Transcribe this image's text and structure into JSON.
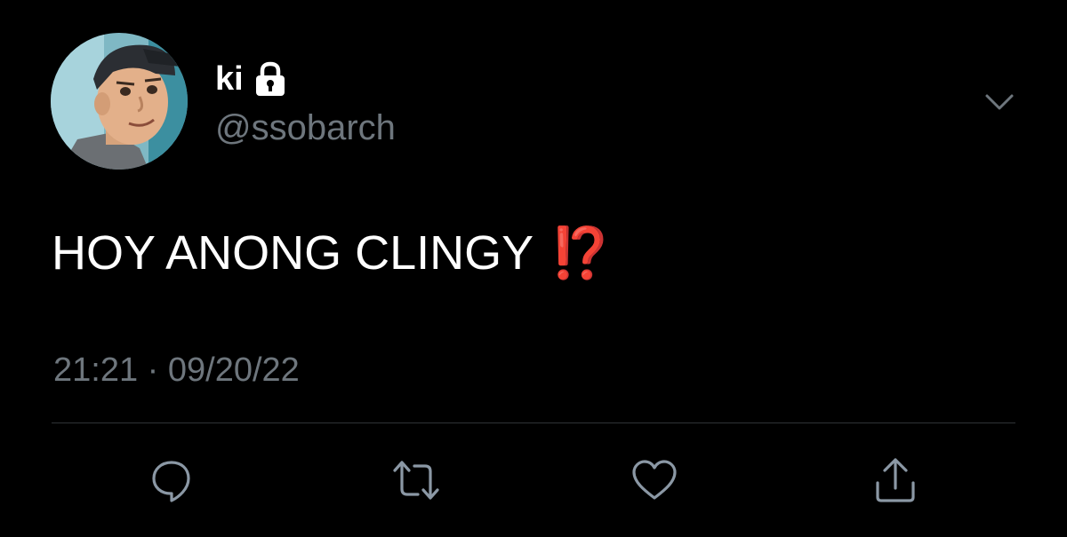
{
  "user": {
    "display_name": "ki",
    "handle": "@ssobarch",
    "protected_icon": "lock-icon",
    "avatar_icon": "avatar-image"
  },
  "tweet": {
    "text": "HOY ANONG CLINGY",
    "emoji": "⁉️",
    "timestamp": "21:21 · 09/20/22"
  },
  "menu_icon": "chevron-down-icon",
  "actions": [
    {
      "name": "reply",
      "icon": "reply-icon"
    },
    {
      "name": "retweet",
      "icon": "retweet-icon"
    },
    {
      "name": "like",
      "icon": "heart-icon"
    },
    {
      "name": "share",
      "icon": "share-icon"
    }
  ],
  "colors": {
    "background": "#000000",
    "primary_text": "#ffffff",
    "secondary_text": "#6e767d",
    "divider": "#2f3336",
    "icon": "#8b98a5",
    "emoji": "#e23a1f"
  }
}
